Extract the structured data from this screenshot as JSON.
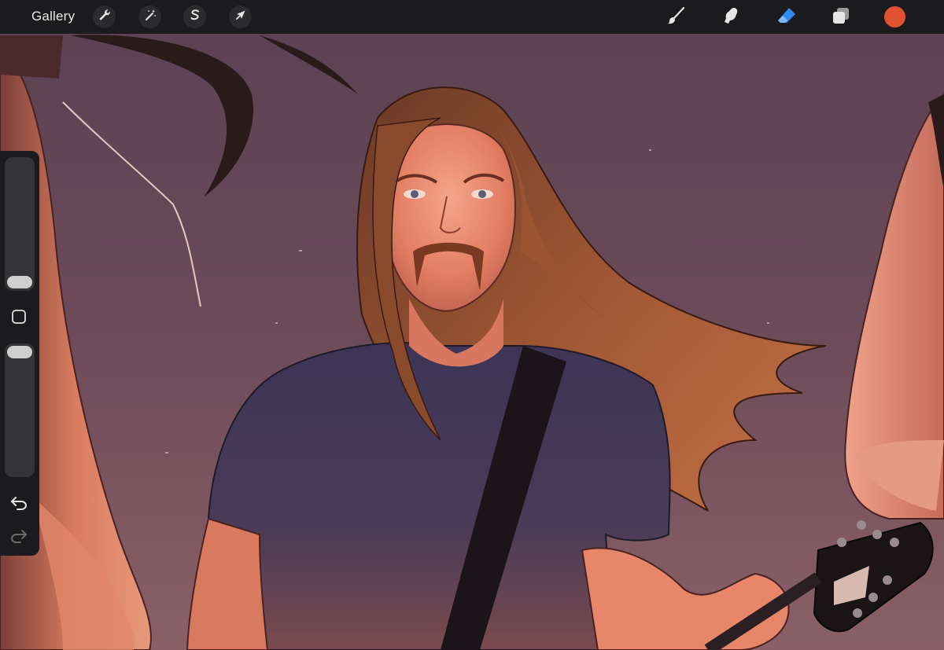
{
  "toolbar": {
    "gallery_label": "Gallery",
    "left_tools": [
      {
        "name": "actions",
        "icon": "wrench-icon"
      },
      {
        "name": "adjustments",
        "icon": "magic-wand-icon"
      },
      {
        "name": "selection",
        "icon": "selection-s-icon"
      },
      {
        "name": "transform",
        "icon": "arrow-cursor-icon"
      }
    ],
    "right_tools": [
      {
        "name": "brush",
        "icon": "brush-icon",
        "active": false
      },
      {
        "name": "smudge",
        "icon": "smudge-finger-icon",
        "active": false
      },
      {
        "name": "eraser",
        "icon": "eraser-icon",
        "active": true
      },
      {
        "name": "layers",
        "icon": "layers-icon",
        "active": false
      }
    ],
    "current_color": "#e0522f",
    "active_tool_color": "#2d8cf0"
  },
  "sidebar": {
    "brush_size_level": 0.0,
    "opacity_level": 1.0,
    "modify_button": "square-icon",
    "undo": "undo-arrow-icon",
    "redo": "redo-arrow-icon"
  },
  "canvas": {
    "background_color": "#6b4a58",
    "description_icon": "illustration-canvas"
  }
}
